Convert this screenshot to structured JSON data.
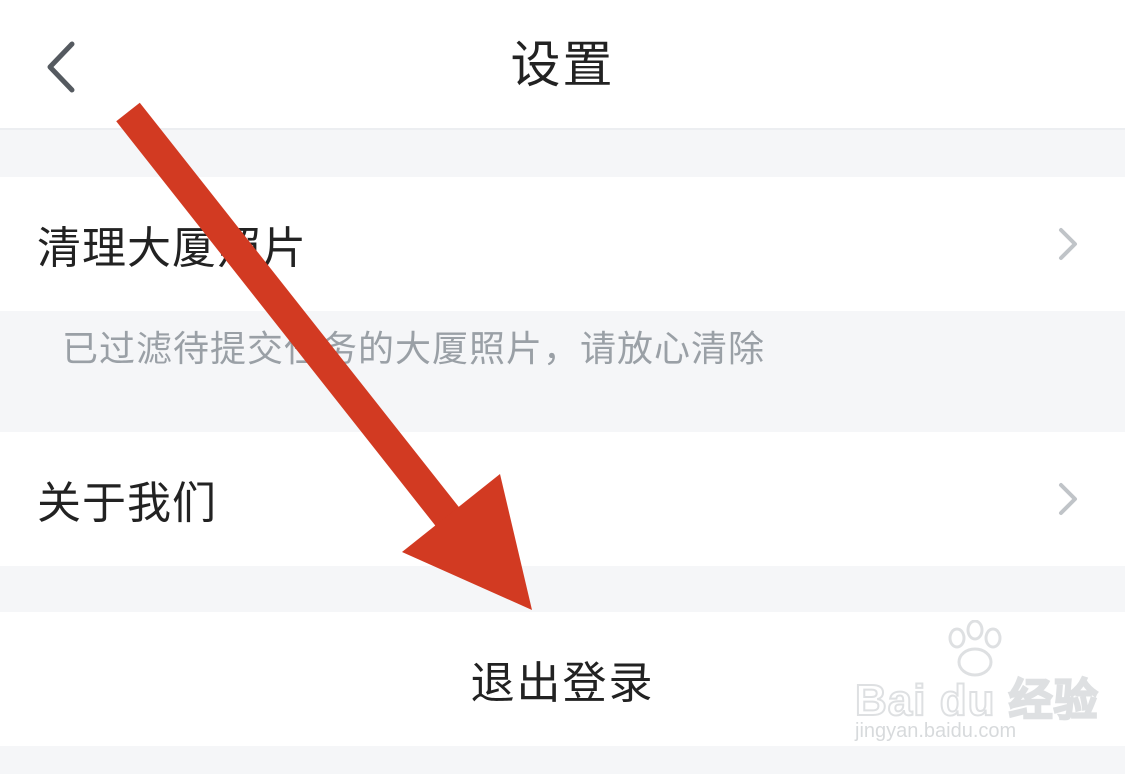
{
  "navbar": {
    "title": "设置"
  },
  "rows": {
    "clean_photos": {
      "label": "清理大厦照片",
      "hint": "已过滤待提交任务的大厦照片，请放心清除"
    },
    "about_us": {
      "label": "关于我们"
    }
  },
  "logout": {
    "label": "退出登录"
  },
  "annotation": {
    "arrow_color": "#d23a22"
  },
  "watermark": {
    "brand": "Bai du 经验",
    "url": "jingyan.baidu.com"
  },
  "colors": {
    "background": "#f5f6f8",
    "surface": "#ffffff",
    "text": "#222222",
    "hint_text": "#9aa0a6",
    "chevron": "#c0c4c8"
  }
}
